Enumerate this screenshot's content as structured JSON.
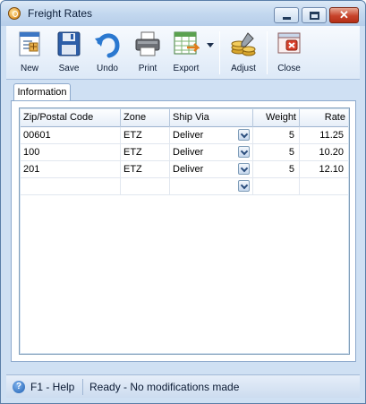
{
  "window": {
    "title": "Freight Rates"
  },
  "toolbar": {
    "buttons": [
      {
        "label": "New",
        "icon": "new-document-icon"
      },
      {
        "label": "Save",
        "icon": "floppy-disk-icon"
      },
      {
        "label": "Undo",
        "icon": "undo-arrow-icon"
      },
      {
        "label": "Print",
        "icon": "printer-icon"
      },
      {
        "label": "Export",
        "icon": "spreadsheet-export-icon"
      },
      {
        "label": "Adjust",
        "icon": "coins-adjust-icon"
      },
      {
        "label": "Close",
        "icon": "close-window-icon"
      }
    ]
  },
  "tabs": [
    {
      "label": "Information",
      "selected": true
    }
  ],
  "grid": {
    "columns": [
      "Zip/Postal Code",
      "Zone",
      "Ship Via",
      "Weight",
      "Rate"
    ],
    "rows": [
      {
        "zip": "00601",
        "zone": "ETZ",
        "ship_via": "Deliver",
        "weight": "5",
        "rate": "11.25"
      },
      {
        "zip": "100",
        "zone": "ETZ",
        "ship_via": "Deliver",
        "weight": "5",
        "rate": "10.20"
      },
      {
        "zip": "201",
        "zone": "ETZ",
        "ship_via": "Deliver",
        "weight": "5",
        "rate": "12.10"
      }
    ]
  },
  "statusbar": {
    "help": "F1 - Help",
    "status": "Ready - No modifications made"
  },
  "colors": {
    "window_frame": "#cfe0f3",
    "title_close": "#c7432b",
    "grid_border": "#7f9db9"
  }
}
